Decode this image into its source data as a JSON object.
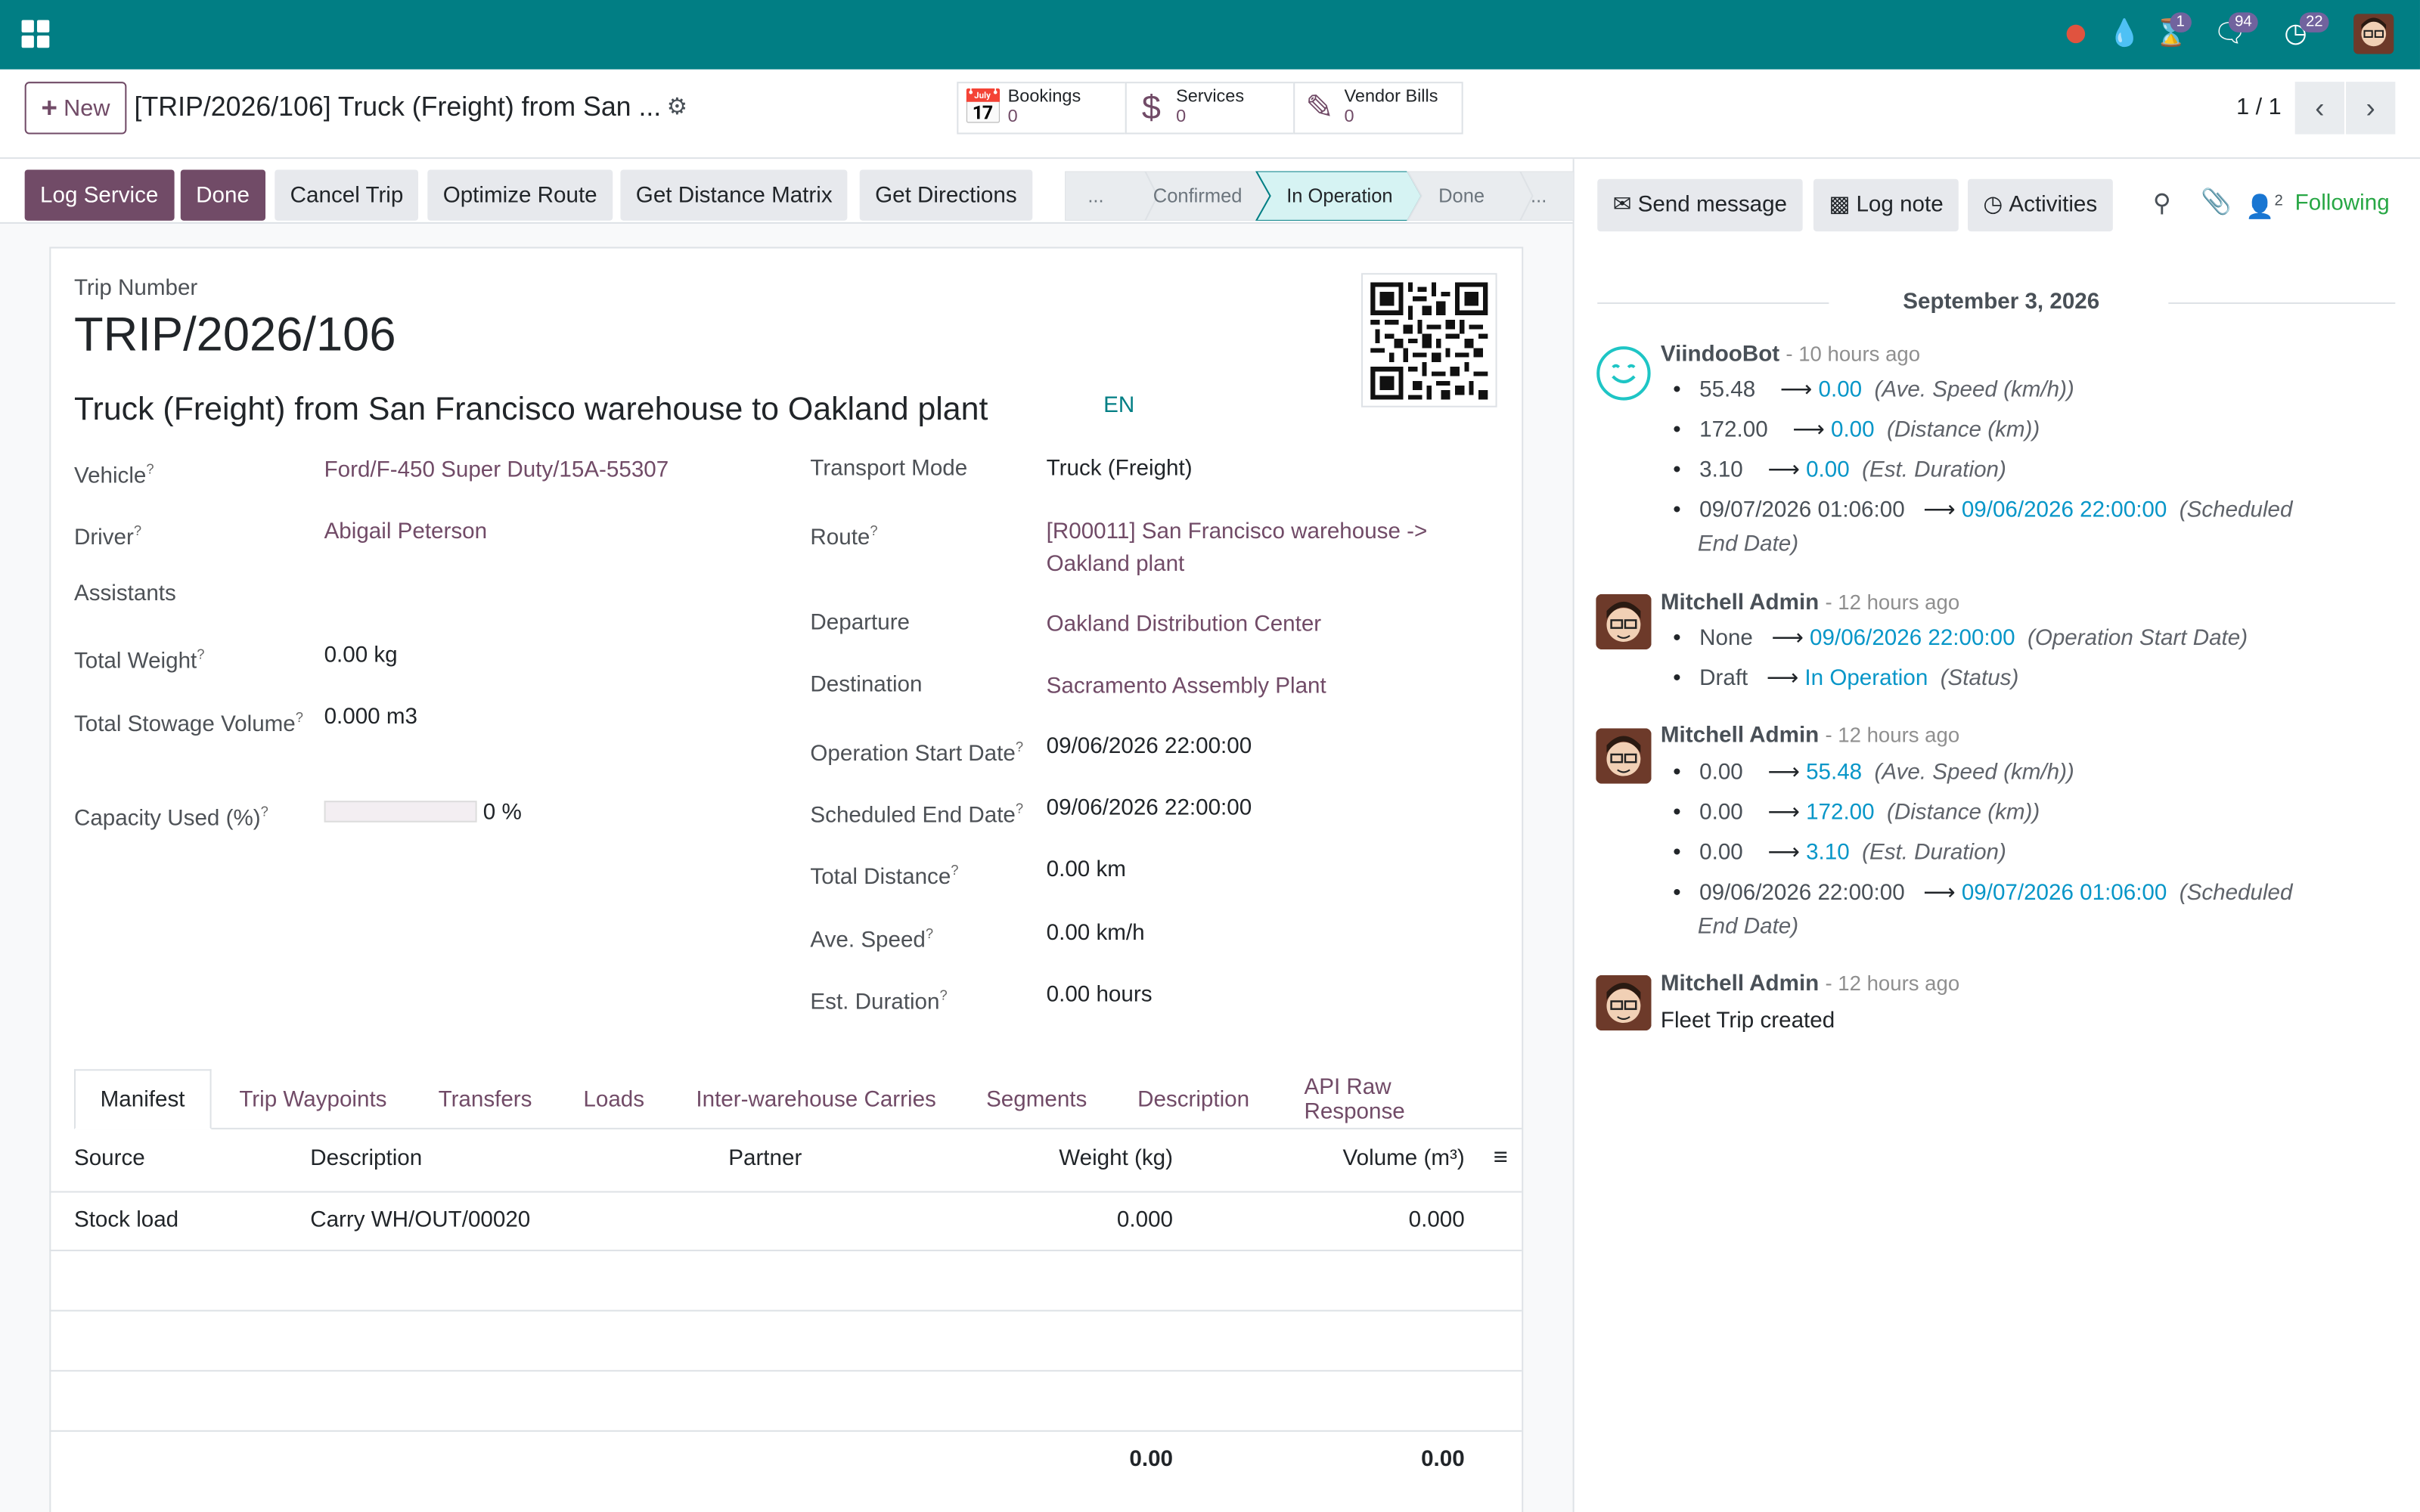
{
  "nav": {
    "activities_count": "1",
    "messages_count": "94",
    "clock_count": "22"
  },
  "control": {
    "new_label": "New",
    "record_title": "[TRIP/2026/106] Truck (Freight) from San ...",
    "smart_buttons": [
      {
        "label": "Bookings",
        "count": "0",
        "icon": "calendar-check-icon"
      },
      {
        "label": "Services",
        "count": "0",
        "icon": "dollar-icon"
      },
      {
        "label": "Vendor Bills",
        "count": "0",
        "icon": "edit-icon"
      }
    ],
    "pager": "1 / 1"
  },
  "header_buttons": {
    "log_service": "Log Service",
    "done": "Done",
    "cancel_trip": "Cancel Trip",
    "optimize_route": "Optimize Route",
    "get_distance_matrix": "Get Distance Matrix",
    "get_directions": "Get Directions"
  },
  "stages": {
    "more_left": "...",
    "confirmed": "Confirmed",
    "in_operation": "In Operation",
    "done": "Done",
    "more_right": "..."
  },
  "form": {
    "trip_number_label": "Trip Number",
    "trip_number": "TRIP/2026/106",
    "name": "Truck (Freight) from San Francisco warehouse to Oakland plant",
    "lang": "EN",
    "left": [
      {
        "label": "Vehicle",
        "value": "Ford/F-450 Super Duty/15A-55307",
        "link": true,
        "help": true
      },
      {
        "label": "Driver",
        "value": "Abigail Peterson",
        "link": true,
        "help": true
      },
      {
        "label": "Assistants",
        "value": "",
        "link": false,
        "help": false
      },
      {
        "label": "Total Weight",
        "value": "0.00 kg",
        "link": false,
        "help": true
      },
      {
        "label": "Total Stowage Volume",
        "value": "0.000 m3",
        "link": false,
        "help": true
      },
      {
        "label": "Capacity Used (%)",
        "value": "0 %",
        "link": false,
        "help": true
      }
    ],
    "capacity_fraction": 0,
    "right": {
      "transport_mode_label": "Transport Mode",
      "transport_mode": "Truck (Freight)",
      "route_label": "Route",
      "route_line1": "[R00011] San Francisco warehouse ->",
      "route_line2": "Oakland plant",
      "departure_label": "Departure",
      "departure": "Oakland Distribution Center",
      "destination_label": "Destination",
      "destination": "Sacramento Assembly Plant",
      "op_start_label": "Operation Start Date",
      "op_start": "09/06/2026 22:00:00",
      "sched_end_label": "Scheduled End Date",
      "sched_end": "09/06/2026 22:00:00",
      "total_distance_label": "Total Distance",
      "total_distance": "0.00 km",
      "ave_speed_label": "Ave. Speed",
      "ave_speed": "0.00 km/h",
      "est_duration_label": "Est. Duration",
      "est_duration": "0.00 hours"
    }
  },
  "tabs": [
    "Manifest",
    "Trip Waypoints",
    "Transfers",
    "Loads",
    "Inter-warehouse Carries",
    "Segments",
    "Description",
    "API Raw Response"
  ],
  "manifest": {
    "columns": {
      "source": "Source",
      "description": "Description",
      "partner": "Partner",
      "weight": "Weight (kg)",
      "volume": "Volume (m³)"
    },
    "rows": [
      {
        "source": "Stock load",
        "description": "Carry WH/OUT/00020",
        "partner": "",
        "weight": "0.000",
        "volume": "0.000"
      }
    ],
    "total_weight": "0.00",
    "total_volume": "0.00"
  },
  "chatter": {
    "send_message": "Send message",
    "log_note": "Log note",
    "activities": "Activities",
    "followers_count": "2",
    "following": "Following",
    "date": "September 3, 2026",
    "messages": [
      {
        "author": "ViindooBot",
        "time": "- 10 hours ago",
        "changes": [
          {
            "old": "55.48",
            "new": "0.00",
            "field": "(Ave. Speed (km/h))"
          },
          {
            "old": "172.00",
            "new": "0.00",
            "field": "(Distance (km))"
          },
          {
            "old": "3.10",
            "new": "0.00",
            "field": "(Est. Duration)"
          },
          {
            "old": "09/07/2026 01:06:00",
            "new": "09/06/2026 22:00:00",
            "field": "(Scheduled",
            "field2": "End Date)"
          }
        ]
      },
      {
        "author": "Mitchell Admin",
        "time": "- 12 hours ago",
        "changes": [
          {
            "old": "None",
            "new": "09/06/2026 22:00:00",
            "field": "(Operation Start Date)"
          },
          {
            "old": "Draft",
            "new": "In Operation",
            "field": "(Status)"
          }
        ]
      },
      {
        "author": "Mitchell Admin",
        "time": "- 12 hours ago",
        "changes": [
          {
            "old": "0.00",
            "new": "55.48",
            "field": "(Ave. Speed (km/h))"
          },
          {
            "old": "0.00",
            "new": "172.00",
            "field": "(Distance (km))"
          },
          {
            "old": "0.00",
            "new": "3.10",
            "field": "(Est. Duration)"
          },
          {
            "old": "09/06/2026 22:00:00",
            "new": "09/07/2026 01:06:00",
            "field": "(Scheduled",
            "field2": "End Date)"
          }
        ]
      },
      {
        "author": "Mitchell Admin",
        "time": "- 12 hours ago",
        "body": "Fleet Trip created"
      }
    ]
  }
}
